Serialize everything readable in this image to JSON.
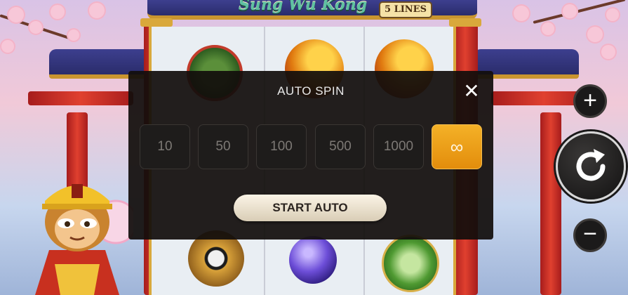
{
  "game": {
    "title": "Sung Wu Kong",
    "lines_badge": "5 LINES"
  },
  "auto_spin_dialog": {
    "title": "AUTO SPIN",
    "close_glyph": "✕",
    "options": [
      {
        "label": "10",
        "selected": false
      },
      {
        "label": "50",
        "selected": false
      },
      {
        "label": "100",
        "selected": false
      },
      {
        "label": "500",
        "selected": false
      },
      {
        "label": "1000",
        "selected": false
      },
      {
        "label": "∞",
        "selected": true
      }
    ],
    "start_label": "START AUTO"
  },
  "controls": {
    "plus_glyph": "+",
    "minus_glyph": "−",
    "spin_icon": "rotate-arrow-icon"
  },
  "colors": {
    "dialog_bg": "#120e0c",
    "selected_option": "#f4b127",
    "start_button": "#f5ecdc"
  }
}
